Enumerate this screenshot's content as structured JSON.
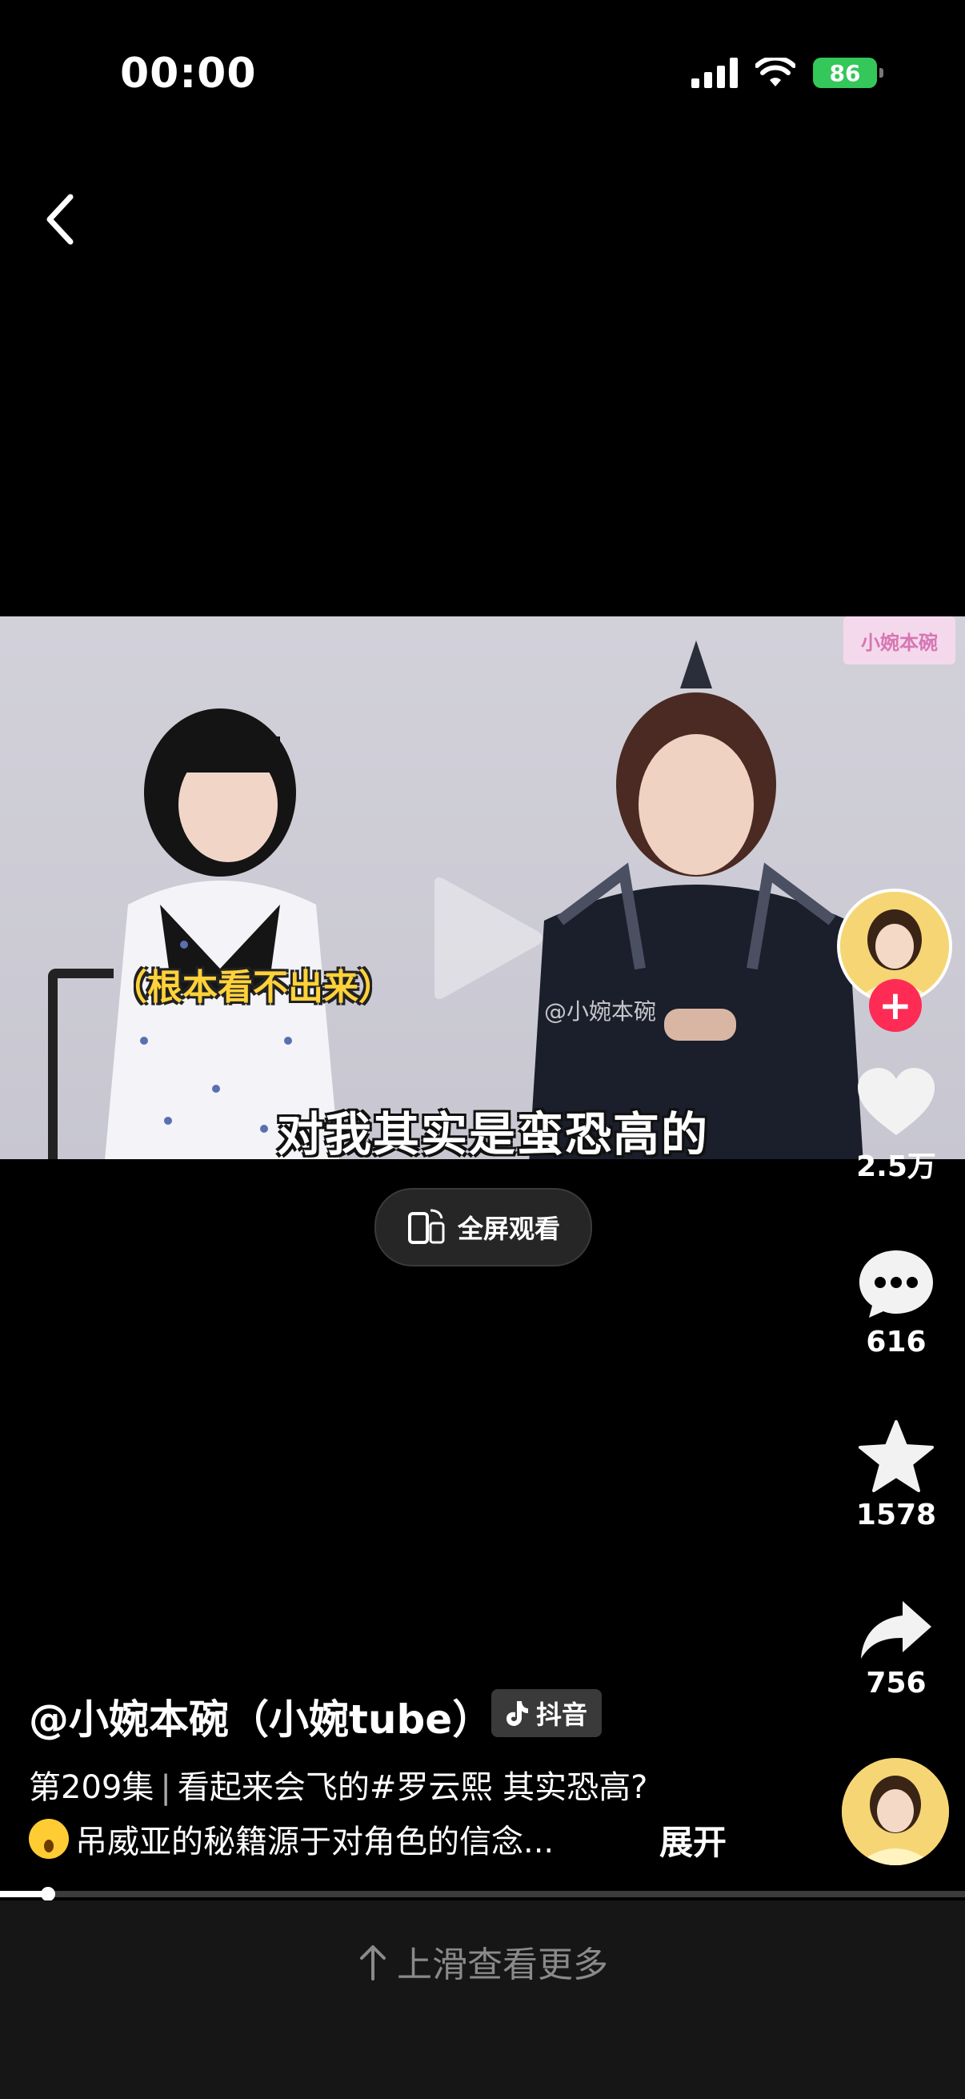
{
  "status_bar": {
    "time": "00:00",
    "battery": "86"
  },
  "video": {
    "caption_top": "（根本看不出来）",
    "caption_bottom": "对我其实是蛮恐高的",
    "watermark": "@小婉本碗",
    "corner_logo": "小婉本碗"
  },
  "fullscreen_button": {
    "label": "全屏观看"
  },
  "actions": {
    "like_count": "2.5万",
    "comment_count": "616",
    "favorite_count": "1578",
    "share_count": "756"
  },
  "post": {
    "author": "@小婉本碗（小婉tube）",
    "source_badge": "抖音",
    "desc_episode": "第209集",
    "desc_title": "看起来会飞的#罗云熙 其实恐高?",
    "desc_line2": "吊威亚的秘籍源于对角色的信念...",
    "expand_label": "展开"
  },
  "progress": {
    "fraction": 0.05
  },
  "bottom": {
    "swipe_hint": "上滑查看更多"
  },
  "colors": {
    "accent": "#fe2c55",
    "battery": "#34c759",
    "caption_yellow": "#ffd23a"
  }
}
